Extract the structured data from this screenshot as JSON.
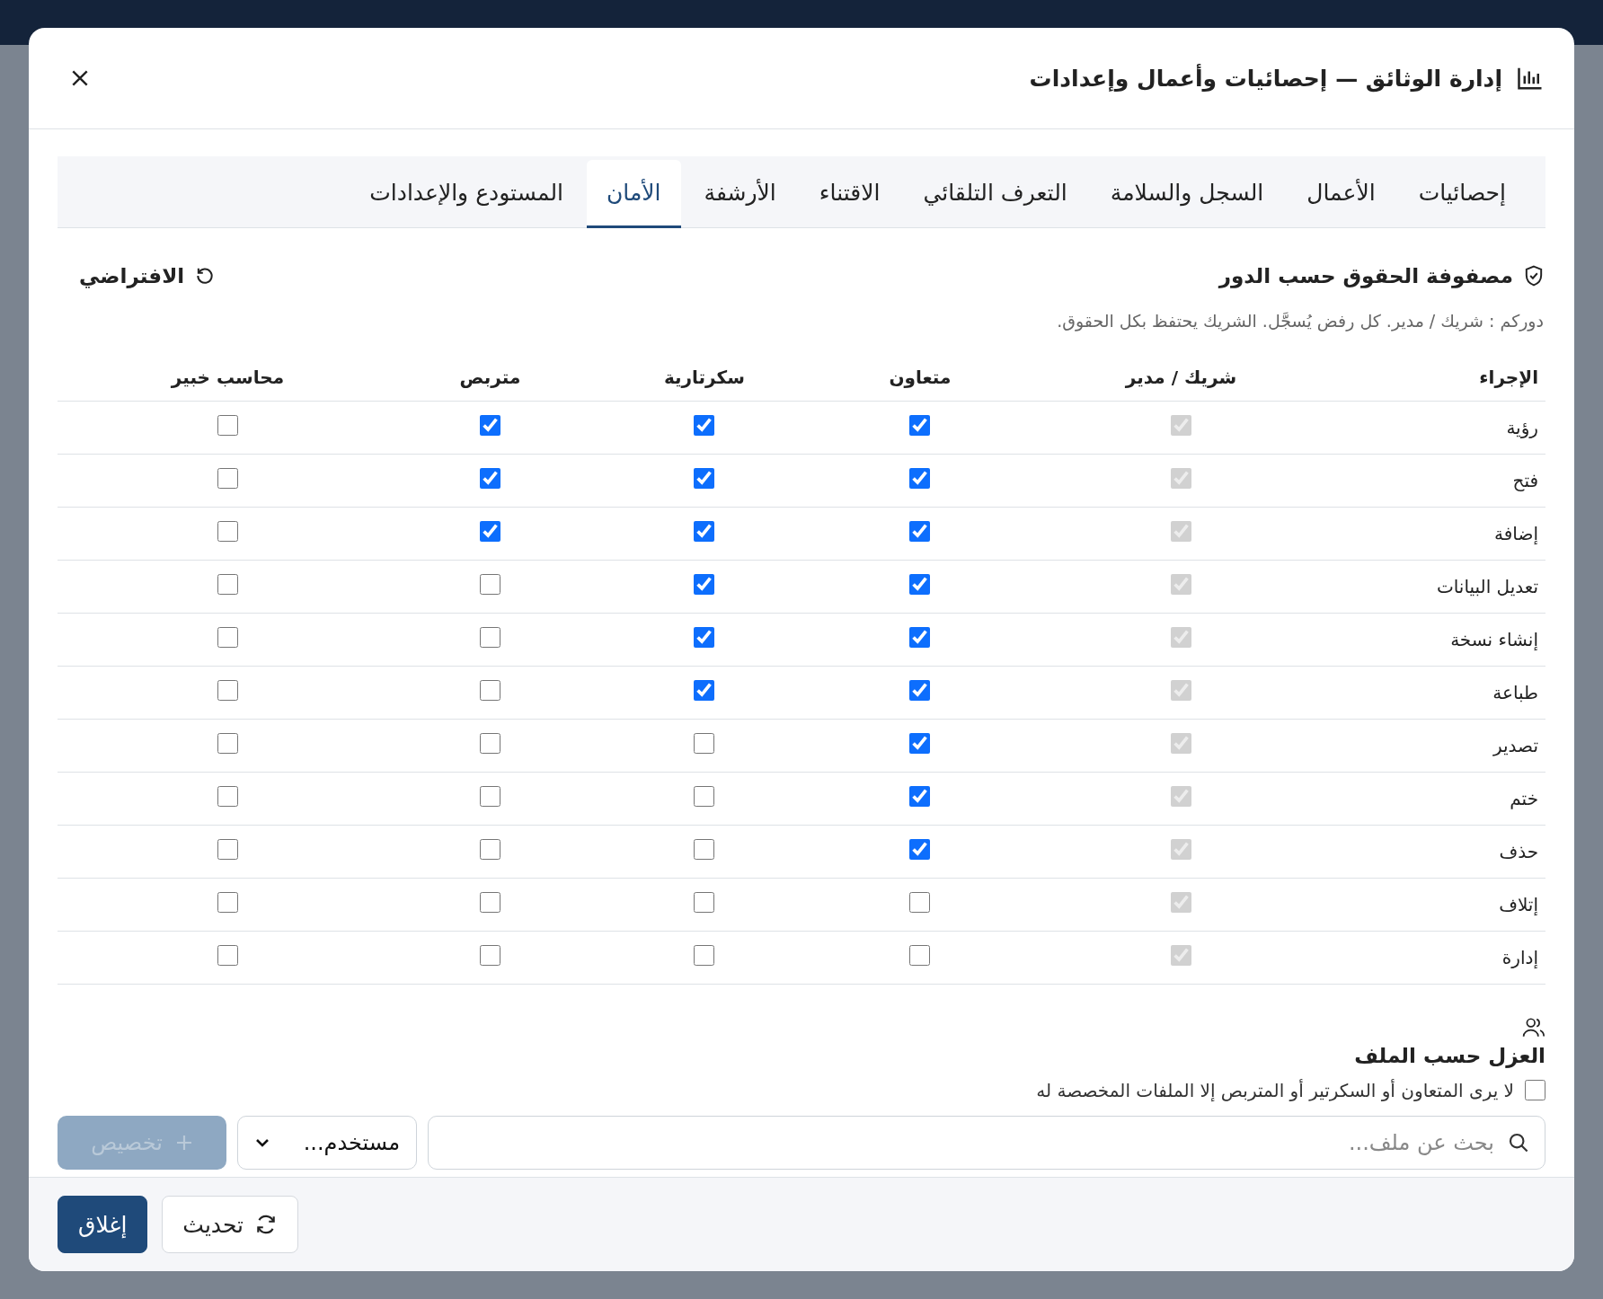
{
  "window": {
    "title": "إدارة الوثائق — إحصائيات وأعمال وإعدادات"
  },
  "tabs": [
    {
      "label": "إحصائيات",
      "selected": false
    },
    {
      "label": "الأعمال",
      "selected": false
    },
    {
      "label": "السجل والسلامة",
      "selected": false
    },
    {
      "label": "التعرف التلقائي",
      "selected": false
    },
    {
      "label": "الاقتناء",
      "selected": false
    },
    {
      "label": "الأرشفة",
      "selected": false
    },
    {
      "label": "الأمان",
      "selected": true
    },
    {
      "label": "المستودع والإعدادات",
      "selected": false
    }
  ],
  "matrix": {
    "title": "مصفوفة الحقوق حسب الدور",
    "reset_label": "الافتراضي",
    "description": "دوركم : شريك / مدير. كل رفض يُسجَّل. الشريك يحتفظ بكل الحقوق.",
    "columns": [
      "الإجراء",
      "شريك / مدير",
      "متعاون",
      "سكرتارية",
      "متربص",
      "محاسب خبير"
    ],
    "rows": [
      {
        "action": "رؤية",
        "cells": [
          {
            "checked": true,
            "disabled": true
          },
          {
            "checked": true,
            "disabled": false
          },
          {
            "checked": true,
            "disabled": false
          },
          {
            "checked": true,
            "disabled": false
          },
          {
            "checked": false,
            "disabled": false
          }
        ]
      },
      {
        "action": "فتح",
        "cells": [
          {
            "checked": true,
            "disabled": true
          },
          {
            "checked": true,
            "disabled": false
          },
          {
            "checked": true,
            "disabled": false
          },
          {
            "checked": true,
            "disabled": false
          },
          {
            "checked": false,
            "disabled": false
          }
        ]
      },
      {
        "action": "إضافة",
        "cells": [
          {
            "checked": true,
            "disabled": true
          },
          {
            "checked": true,
            "disabled": false
          },
          {
            "checked": true,
            "disabled": false
          },
          {
            "checked": true,
            "disabled": false
          },
          {
            "checked": false,
            "disabled": false
          }
        ]
      },
      {
        "action": "تعديل البيانات",
        "cells": [
          {
            "checked": true,
            "disabled": true
          },
          {
            "checked": true,
            "disabled": false
          },
          {
            "checked": true,
            "disabled": false
          },
          {
            "checked": false,
            "disabled": false
          },
          {
            "checked": false,
            "disabled": false
          }
        ]
      },
      {
        "action": "إنشاء نسخة",
        "cells": [
          {
            "checked": true,
            "disabled": true
          },
          {
            "checked": true,
            "disabled": false
          },
          {
            "checked": true,
            "disabled": false
          },
          {
            "checked": false,
            "disabled": false
          },
          {
            "checked": false,
            "disabled": false
          }
        ]
      },
      {
        "action": "طباعة",
        "cells": [
          {
            "checked": true,
            "disabled": true
          },
          {
            "checked": true,
            "disabled": false
          },
          {
            "checked": true,
            "disabled": false
          },
          {
            "checked": false,
            "disabled": false
          },
          {
            "checked": false,
            "disabled": false
          }
        ]
      },
      {
        "action": "تصدير",
        "cells": [
          {
            "checked": true,
            "disabled": true
          },
          {
            "checked": true,
            "disabled": false
          },
          {
            "checked": false,
            "disabled": false
          },
          {
            "checked": false,
            "disabled": false
          },
          {
            "checked": false,
            "disabled": false
          }
        ]
      },
      {
        "action": "ختم",
        "cells": [
          {
            "checked": true,
            "disabled": true
          },
          {
            "checked": true,
            "disabled": false
          },
          {
            "checked": false,
            "disabled": false
          },
          {
            "checked": false,
            "disabled": false
          },
          {
            "checked": false,
            "disabled": false
          }
        ]
      },
      {
        "action": "حذف",
        "cells": [
          {
            "checked": true,
            "disabled": true
          },
          {
            "checked": true,
            "disabled": false
          },
          {
            "checked": false,
            "disabled": false
          },
          {
            "checked": false,
            "disabled": false
          },
          {
            "checked": false,
            "disabled": false
          }
        ]
      },
      {
        "action": "إتلاف",
        "cells": [
          {
            "checked": true,
            "disabled": true
          },
          {
            "checked": false,
            "disabled": false
          },
          {
            "checked": false,
            "disabled": false
          },
          {
            "checked": false,
            "disabled": false
          },
          {
            "checked": false,
            "disabled": false
          }
        ]
      },
      {
        "action": "إدارة",
        "cells": [
          {
            "checked": true,
            "disabled": true
          },
          {
            "checked": false,
            "disabled": false
          },
          {
            "checked": false,
            "disabled": false
          },
          {
            "checked": false,
            "disabled": false
          },
          {
            "checked": false,
            "disabled": false
          }
        ]
      }
    ]
  },
  "isolation": {
    "title": "العزل حسب الملف",
    "option": {
      "label": "لا يرى المتعاون أو السكرتير أو المتربص إلا الملفات المخصصة له",
      "checked": false
    },
    "search": {
      "placeholder": "بحث عن ملف..."
    },
    "user_select": {
      "value": "مستخدم..."
    },
    "assign_button": {
      "label": "تخصيص",
      "disabled": true
    }
  },
  "footer": {
    "buttons": [
      {
        "label": "تحديث",
        "kind": "refresh"
      },
      {
        "label": "إغلاق",
        "kind": "primary"
      }
    ]
  }
}
